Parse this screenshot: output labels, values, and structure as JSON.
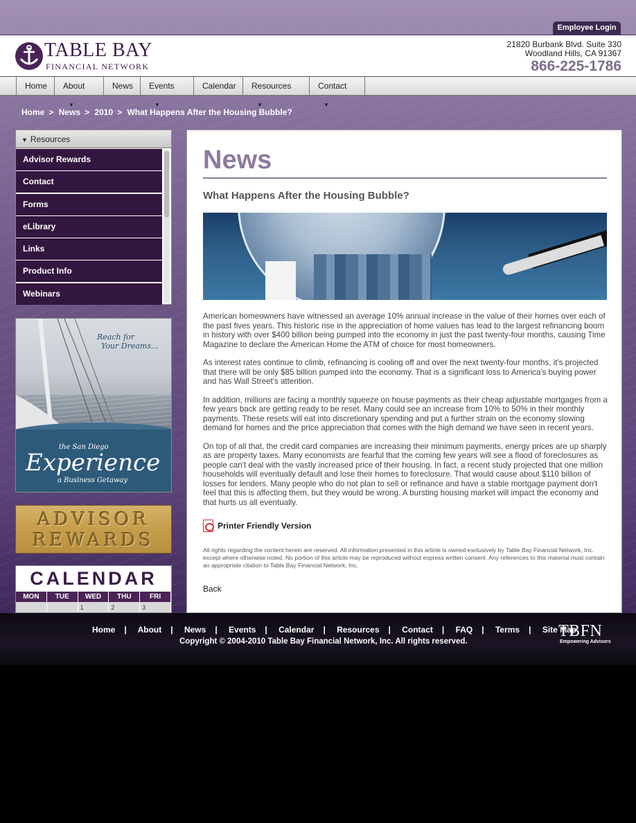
{
  "header": {
    "employee_login": "Employee Login",
    "logo_main": "TABLE BAY",
    "logo_sub": "FINANCIAL NETWORK",
    "address_line1": "21820 Burbank Blvd. Suite 330",
    "address_line2": "Woodland Hills, CA 91367",
    "phone": "866-225-1786"
  },
  "nav": {
    "items": [
      {
        "label": "Home",
        "dropdown": false
      },
      {
        "label": "About",
        "dropdown": true
      },
      {
        "label": "News",
        "dropdown": false
      },
      {
        "label": "Events",
        "dropdown": true
      },
      {
        "label": "Calendar",
        "dropdown": false
      },
      {
        "label": "Resources",
        "dropdown": true
      },
      {
        "label": "Contact",
        "dropdown": true
      }
    ]
  },
  "breadcrumb": [
    "Home",
    "News",
    "2010",
    "What Happens After the Housing Bubble?"
  ],
  "sidebar": {
    "header": "Resources",
    "items": [
      "Advisor Rewards",
      "Contact",
      "Forms",
      "eLibrary",
      "Links",
      "Product Info",
      "Webinars"
    ]
  },
  "promos": {
    "sail_reach": "Reach for",
    "sail_dreams": "Your Dreams...",
    "sail_sd": "the San Diego",
    "sail_experience": "Experience",
    "sail_getaway": "a Business Getaway",
    "rewards_l1": "ADVISOR",
    "rewards_l2": "REWARDS",
    "calendar_title": "CALENDAR",
    "calendar_days": [
      "MON",
      "TUE",
      "WED",
      "THU",
      "FRI"
    ],
    "calendar_nums": [
      "",
      "",
      "1",
      "2",
      "3"
    ]
  },
  "main": {
    "title": "News",
    "article_title": "What Happens After the Housing Bubble?",
    "paragraphs": [
      "American homeowners have witnessed an average 10% annual increase in the value of their homes over each of the past fives years. This historic rise in the appreciation of home values has lead to the largest refinancing boom in history with over $400 billion being pumped into the economy in just the past twenty-four months, causing Time Magazine to declare the American Home the ATM of choice for most homeowners.",
      "As interest rates continue to climb, refinancing is cooling off and over the next twenty-four months, it's projected that there will be only $85 billion pumped into the economy. That is a significant loss to America's buying power and has Wall Street's attention.",
      "In addition, millions are facing a monthly squeeze on house payments as their cheap adjustable mortgages from a few years back are getting ready to be reset. Many could see an increase from 10% to 50% in their monthly payments. These resets will eat into discretionary spending and put a further strain on the economy slowing demand for homes and the price appreciation that comes with the high demand we have seen in recent years.",
      "On top of all that, the credit card companies are increasing their minimum payments, energy prices are up sharply as are property taxes. Many economists are fearful that the coming few years will see a flood of foreclosures as people can't deal with the vastly increased price of their housing. In fact, a recent study projected that one million households will eventually default and lose their homes to foreclosure. That would cause about $110 billion of losses for lenders. Many people who do not plan to sell or refinance and have a stable mortgage payment don't feel that this is affecting them, but they would be wrong. A bursting housing market will impact the economy and that hurts us all eventually."
    ],
    "printer_link": "Printer Friendly Version",
    "rights": "All rights regarding the content herein are reserved. All information presented in this article is owned exclusively by Table Bay Financial Network, Inc. except where otherwise noted. No portion of this article may be reproduced without express written consent. Any references to this material must contain an appropriate citation to Table Bay Financial Network, Inc.",
    "back": "Back"
  },
  "footer": {
    "links": [
      "Home",
      "About",
      "News",
      "Events",
      "Calendar",
      "Resources",
      "Contact",
      "FAQ",
      "Terms",
      "Site Map"
    ],
    "separator": "|",
    "copyright": "Copyright © 2004-2010 Table Bay Financial Network, Inc. All rights reserved.",
    "logo": "TBFN",
    "tagline": "Empowering Advisors"
  },
  "icons": {
    "logo": "anchor-logo-icon",
    "nav_caret": "caret-down-icon",
    "sidebar_toggle": "triangle-down-icon",
    "printer": "pdf-icon"
  },
  "colors": {
    "brand_purple": "#3a1e4a",
    "sidebar_item": "#33163f",
    "title_lavender": "#8c7aa0"
  }
}
